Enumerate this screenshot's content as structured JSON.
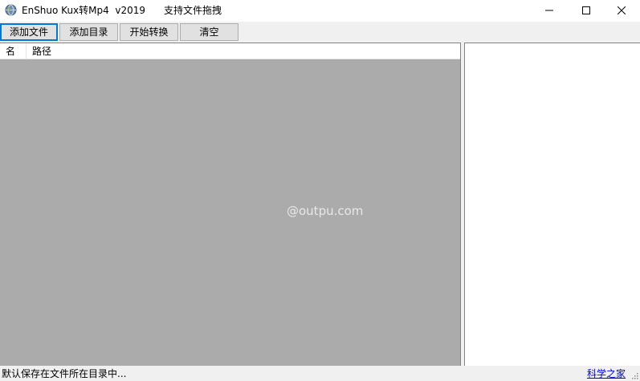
{
  "window": {
    "title": "EnShuo Kux转Mp4  v2019",
    "subtitle": "支持文件拖拽",
    "icon": "globe-icon"
  },
  "toolbar": {
    "add_file_label": "添加文件",
    "add_dir_label": "添加目录",
    "start_label": "开始转换",
    "clear_label": "清空"
  },
  "list": {
    "columns": [
      "名",
      "路径"
    ],
    "background_color": "#ababab"
  },
  "watermark": "@outpu.com",
  "statusbar": {
    "text": "默认保存在文件所在目录中...",
    "link_label": "科学之家"
  },
  "colors": {
    "focus_border": "#0078d7",
    "link": "#0000ee"
  }
}
